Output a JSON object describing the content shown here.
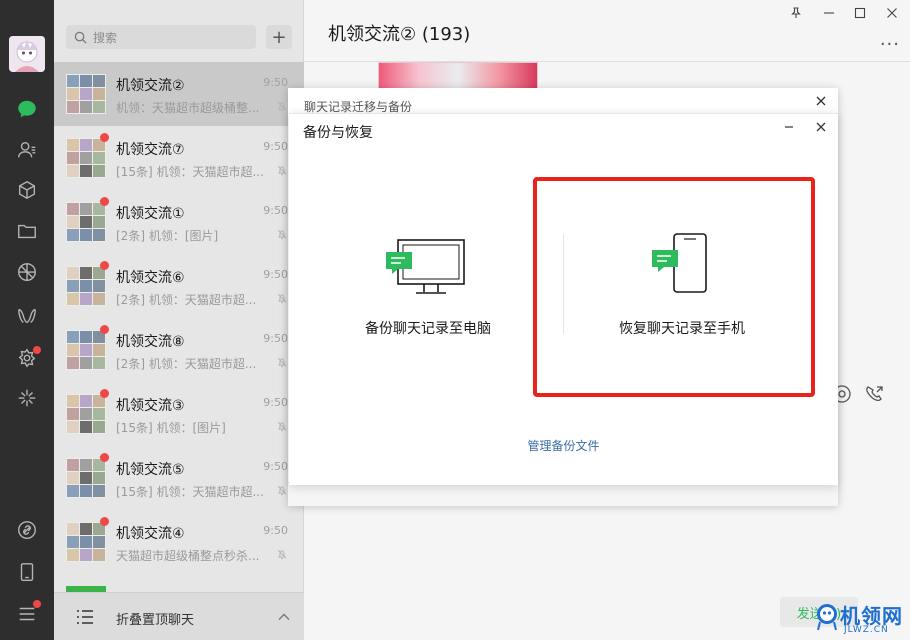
{
  "sidebar": {
    "icons": [
      "chat-icon",
      "contacts-icon",
      "collection-icon",
      "files-icon",
      "moments-icon",
      "search-icon",
      "mini-program-icon",
      "channels-icon"
    ],
    "bottom_icons": [
      "link-icon",
      "phone-icon",
      "menu-icon"
    ]
  },
  "chat_list": {
    "search_placeholder": "搜索",
    "add_label": "+",
    "rows": [
      {
        "name": "机领交流②",
        "time": "9:50",
        "preview": "机领：天猫超市超级桶整..."
      },
      {
        "name": "机领交流⑦",
        "time": "9:50",
        "preview": "[15条] 机领：天猫超市超..."
      },
      {
        "name": "机领交流①",
        "time": "9:50",
        "preview": "[2条] 机领：[图片]"
      },
      {
        "name": "机领交流⑥",
        "time": "9:50",
        "preview": "[2条] 机领：天猫超市超..."
      },
      {
        "name": "机领交流⑧",
        "time": "9:50",
        "preview": "[2条] 机领：天猫超市超..."
      },
      {
        "name": "机领交流③",
        "time": "9:50",
        "preview": "[15条] 机领：[图片]"
      },
      {
        "name": "机领交流⑤",
        "time": "9:50",
        "preview": "[15条] 机领：天猫超市超..."
      },
      {
        "name": "机领交流④",
        "time": "9:50",
        "preview": "天猫超市超级桶整点秒杀..."
      }
    ],
    "fold_label": "折叠置顶聊天"
  },
  "chat": {
    "title": "机领交流② (193)",
    "send_label": "发送(S)"
  },
  "dialog_back": {
    "title": "聊天记录迁移与备份"
  },
  "dialog_front": {
    "title": "备份与恢复",
    "backup_label": "备份聊天记录至电脑",
    "restore_label": "恢复聊天记录至手机",
    "manage_link": "管理备份文件"
  },
  "watermark": {
    "cn": "机领网",
    "en": "JLWZ.CN"
  },
  "colors": {
    "accent_green": "#2dbb5e",
    "highlight_red": "#e8231c",
    "link_blue": "#3b6ea8"
  }
}
